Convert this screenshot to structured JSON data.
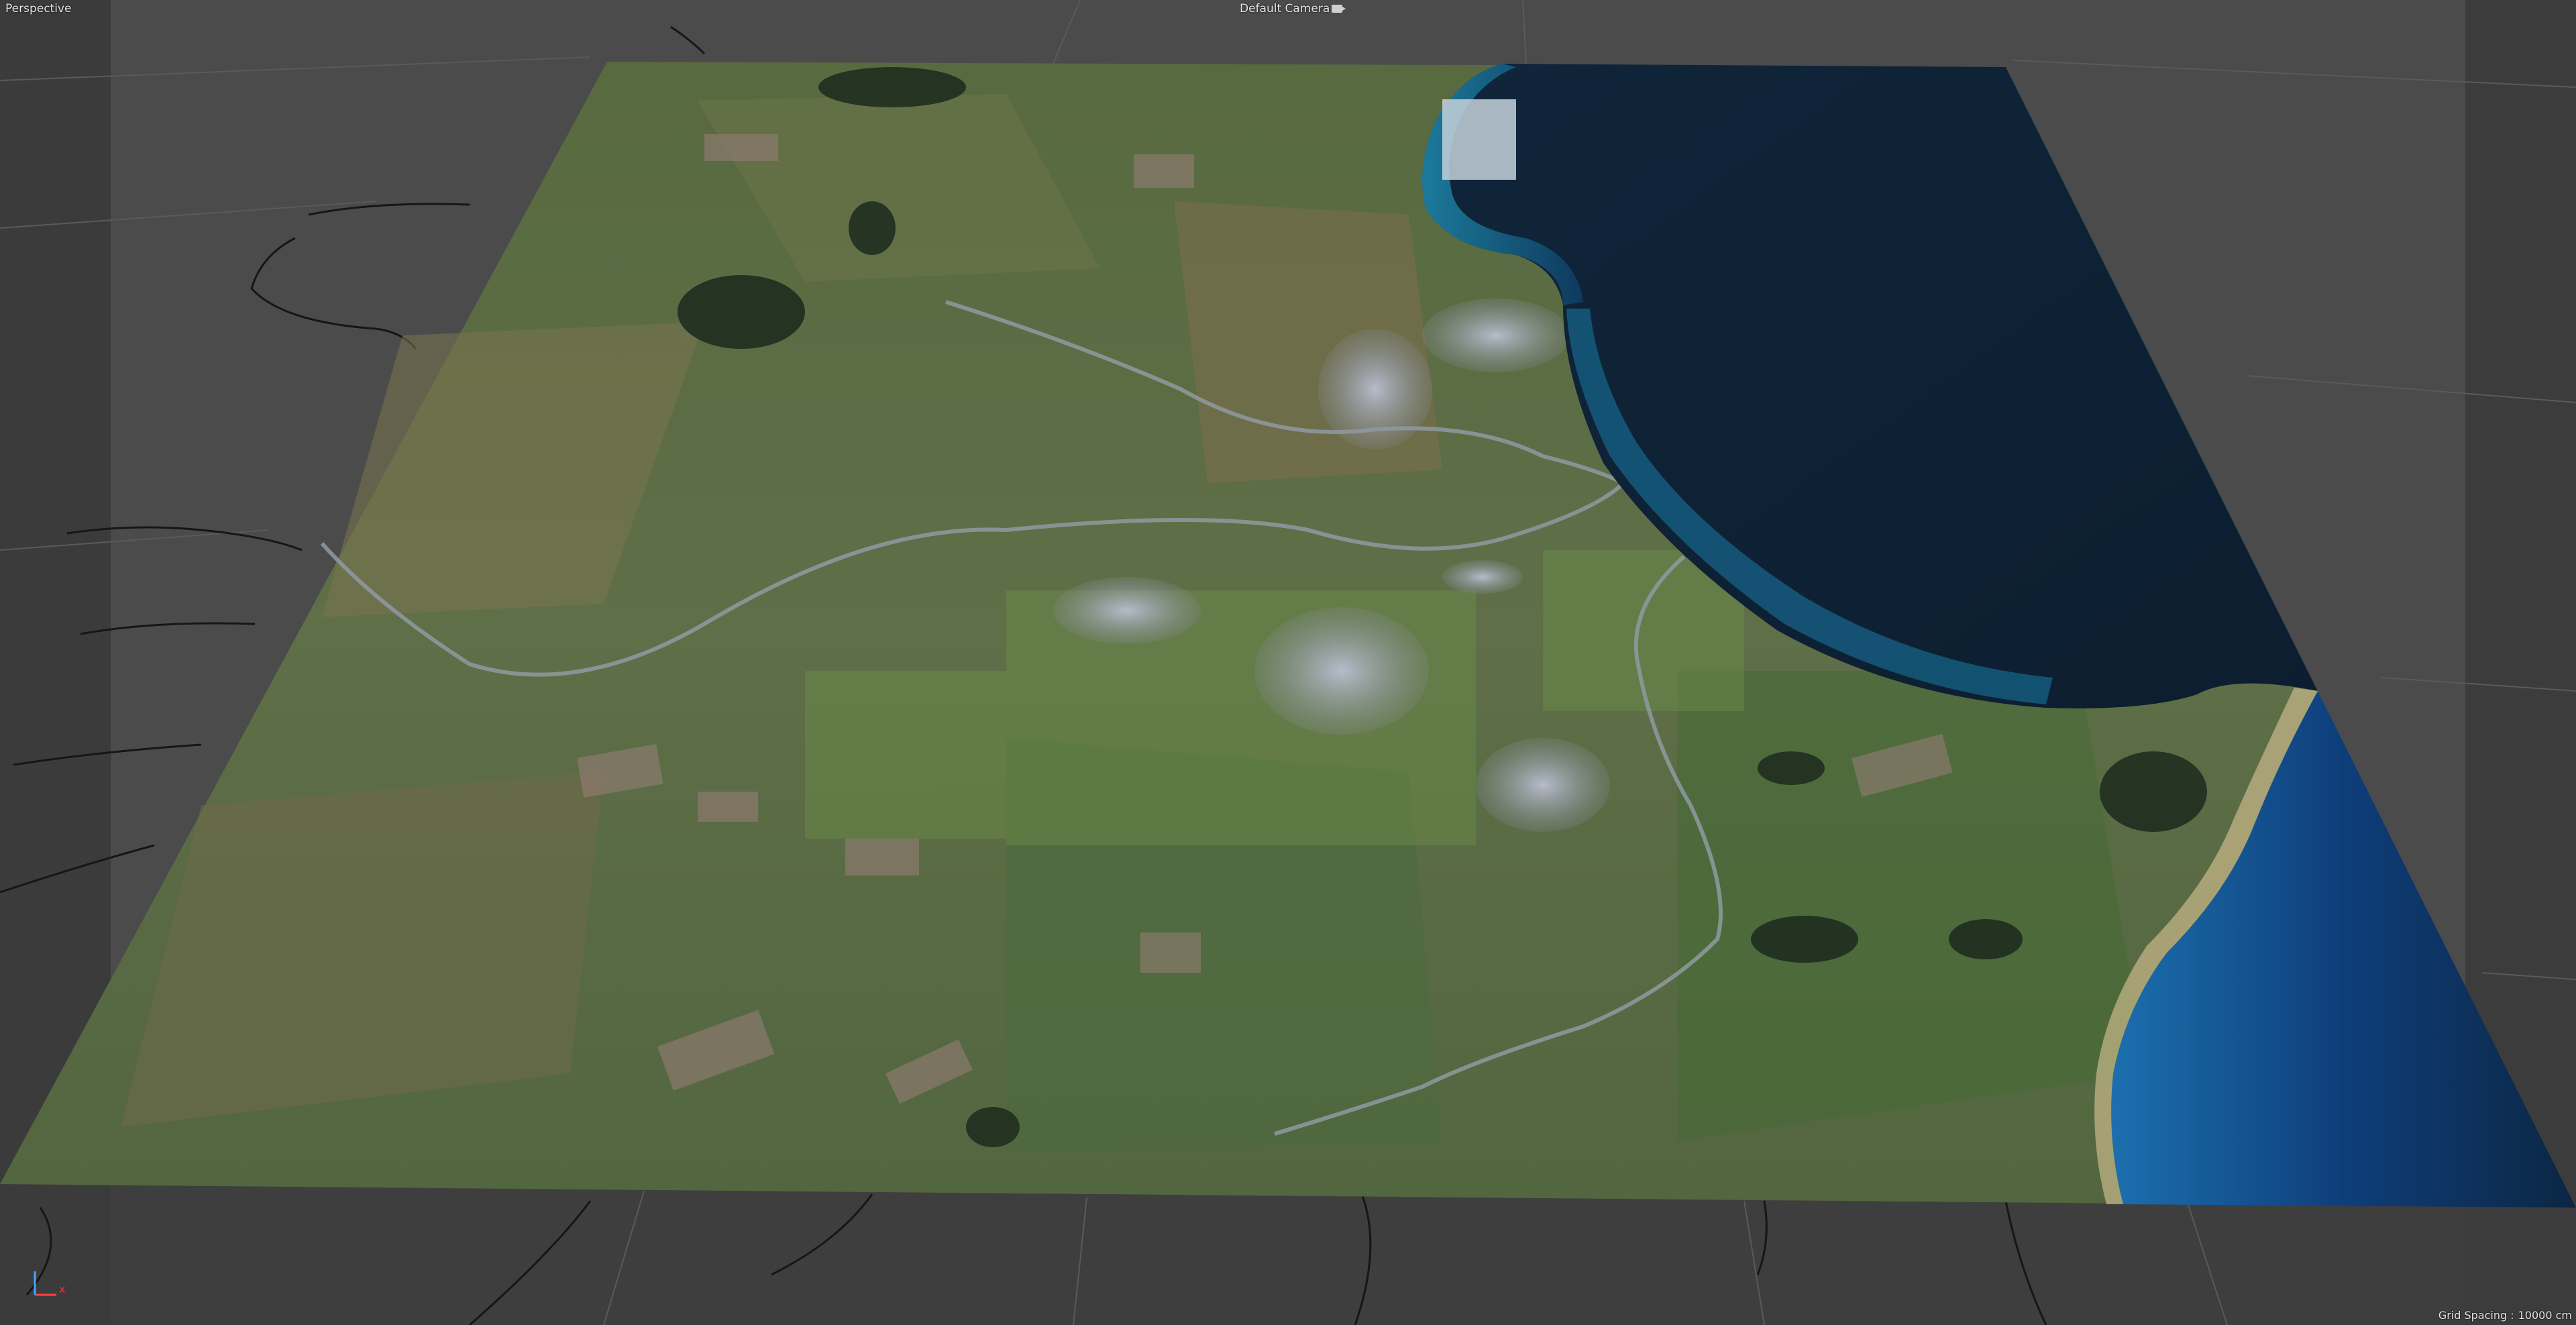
{
  "viewport": {
    "view_label": "Perspective",
    "camera_label": "Default Camera",
    "grid_spacing_label": "Grid Spacing :",
    "grid_spacing_value": "10000 cm",
    "axis_label_x": "x",
    "background_color": "#4b4b4b",
    "ocean_color": "#0f2236",
    "terrain_color": "#5d6d46"
  },
  "icons": {
    "camera": "camera-icon",
    "axis": "axis-gizmo-icon"
  }
}
